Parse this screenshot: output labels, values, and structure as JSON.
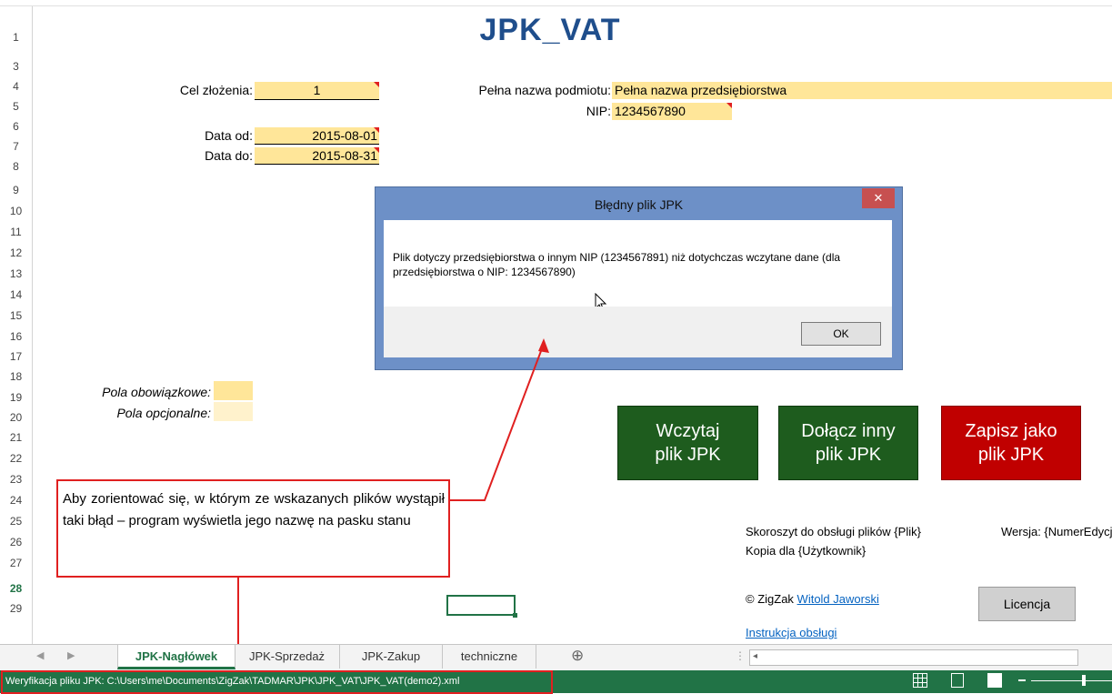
{
  "sheet": {
    "title": "JPK_VAT",
    "row_numbers": [
      "1",
      "3",
      "4",
      "5",
      "6",
      "7",
      "8",
      "9",
      "10",
      "11",
      "12",
      "13",
      "14",
      "15",
      "16",
      "17",
      "18",
      "19",
      "20",
      "21",
      "22",
      "23",
      "24",
      "25",
      "26",
      "27",
      "28",
      "29"
    ],
    "active_row": "28"
  },
  "form": {
    "cel_label": "Cel złożenia:",
    "cel_value": "1",
    "data_od_label": "Data od:",
    "data_od_value": "2015-08-01",
    "data_do_label": "Data do:",
    "data_do_value": "2015-08-31",
    "nazwa_label": "Pełna nazwa podmiotu:",
    "nazwa_value": "Pełna nazwa przedsiębiorstwa",
    "nip_label": "NIP:",
    "nip_value": "1234567890"
  },
  "legend": {
    "required_label": "Pola obowiązkowe:",
    "optional_label": "Pola opcjonalne:"
  },
  "buttons": {
    "load": [
      "Wczytaj",
      "plik JPK"
    ],
    "append": [
      "Dołącz inny",
      "plik JPK"
    ],
    "save": [
      "Zapisz jako",
      "plik JPK"
    ],
    "license": "Licencja"
  },
  "info": {
    "workbook_line": "Skoroszyt do obsługi plików {Plik}",
    "version_line": "Wersja: {NumerEdycj",
    "copy_line": "Kopia dla {Użytkownik}",
    "copyright_prefix": "© ZigZak",
    "author_link": "Witold Jaworski",
    "manual_link": "Instrukcja obsługi"
  },
  "dialog": {
    "title": "Błędny plik JPK",
    "close": "✕",
    "message": "Plik dotyczy przedsiębiorstwa o innym NIP (1234567891) niż dotychczas wczytane dane (dla przedsiębiorstwa o NIP: 1234567890)",
    "ok": "OK"
  },
  "callout": {
    "text": "Aby zorientować się, w którym ze wskazanych plików wystąpił taki błąd – program wyświetla jego nazwę na pasku stanu"
  },
  "tabs": [
    {
      "label": "JPK-Nagłówek",
      "active": true
    },
    {
      "label": "JPK-Sprzedaż",
      "active": false
    },
    {
      "label": "JPK-Zakup",
      "active": false
    },
    {
      "label": "techniczne",
      "active": false
    }
  ],
  "tab_add": "⊕",
  "status": {
    "text": "Weryfikacja pliku JPK: C:\\Users\\me\\Documents\\ZigZak\\TADMAR\\JPK\\JPK_VAT\\JPK_VAT(demo2).xml"
  },
  "colors": {
    "required": "#ffe699",
    "optional": "#fff2cc",
    "green_button": "#1e5c1e",
    "red_button": "#c00000",
    "status_bar": "#217346",
    "highlight": "#e02020"
  }
}
